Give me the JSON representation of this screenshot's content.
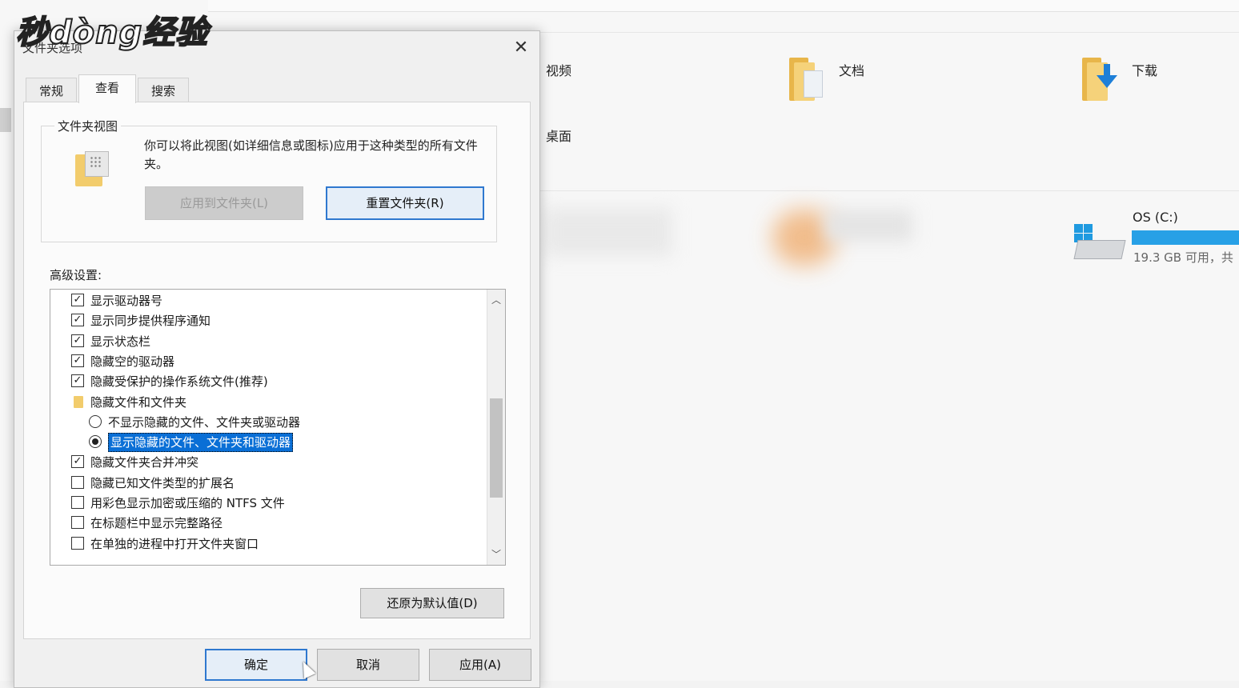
{
  "watermark": "秒dòng经验",
  "explorer": {
    "items": [
      {
        "label": "视频"
      },
      {
        "label": "文档"
      },
      {
        "label": "下载"
      },
      {
        "label": "桌面"
      }
    ],
    "drive": {
      "name": "OS (C:)",
      "free_text": "19.3 GB 可用，共",
      "usage_fraction": 0.85
    }
  },
  "dialog": {
    "title": "文件夹选项",
    "close_glyph": "✕",
    "tabs": [
      {
        "label": "常规"
      },
      {
        "label": "查看",
        "active": true
      },
      {
        "label": "搜索"
      }
    ],
    "folder_views": {
      "legend": "文件夹视图",
      "description": "你可以将此视图(如详细信息或图标)应用于这种类型的所有文件夹。",
      "apply_button": "应用到文件夹(L)",
      "reset_button": "重置文件夹(R)"
    },
    "advanced": {
      "label": "高级设置:",
      "items": [
        {
          "type": "checkbox",
          "checked": true,
          "label": "显示驱动器号"
        },
        {
          "type": "checkbox",
          "checked": true,
          "label": "显示同步提供程序通知"
        },
        {
          "type": "checkbox",
          "checked": true,
          "label": "显示状态栏"
        },
        {
          "type": "checkbox",
          "checked": true,
          "label": "隐藏空的驱动器"
        },
        {
          "type": "checkbox",
          "checked": true,
          "label": "隐藏受保护的操作系统文件(推荐)"
        },
        {
          "type": "folder",
          "label": "隐藏文件和文件夹"
        },
        {
          "type": "radio",
          "checked": false,
          "label": "不显示隐藏的文件、文件夹或驱动器"
        },
        {
          "type": "radio",
          "checked": true,
          "selected": true,
          "label": "显示隐藏的文件、文件夹和驱动器"
        },
        {
          "type": "checkbox",
          "checked": true,
          "label": "隐藏文件夹合并冲突"
        },
        {
          "type": "checkbox",
          "checked": false,
          "label": "隐藏已知文件类型的扩展名"
        },
        {
          "type": "checkbox",
          "checked": false,
          "label": "用彩色显示加密或压缩的 NTFS 文件"
        },
        {
          "type": "checkbox",
          "checked": false,
          "label": "在标题栏中显示完整路径"
        },
        {
          "type": "checkbox",
          "checked": false,
          "label": "在单独的进程中打开文件夹窗口"
        }
      ],
      "check_glyph": "✓",
      "scroll_up_glyph": "︿",
      "scroll_down_glyph": "﹀"
    },
    "restore_button": "还原为默认值(D)",
    "ok_button": "确定",
    "cancel_button": "取消",
    "apply_button": "应用(A)"
  },
  "colors": {
    "selection": "#0a6fd6",
    "drive_bar": "#27a0e6",
    "primary_border": "#2f78cf"
  }
}
